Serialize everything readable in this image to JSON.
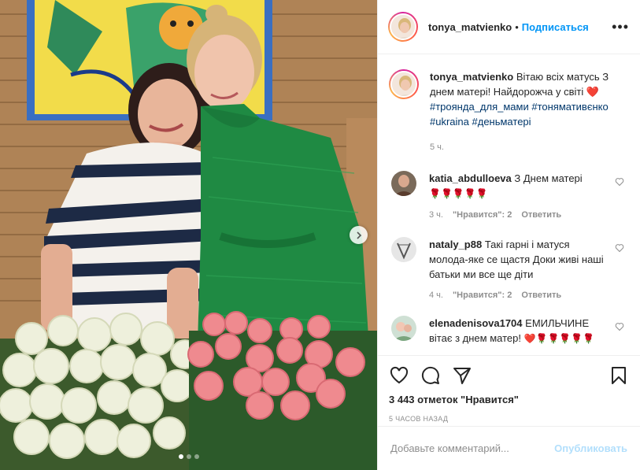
{
  "post": {
    "username": "tonya_matvienko",
    "separator": "•",
    "follow_label": "Подписаться",
    "more_label": "•••"
  },
  "caption": {
    "username": "tonya_matvienko",
    "text": "Вітаю всіх матусь З днем матері! Найдорожча у світі",
    "heart_emoji": "❤️",
    "tags": [
      "#троянда_для_мами",
      "#тонямативєнко",
      "#ukraina",
      "#деньматері"
    ],
    "time": "5 ч."
  },
  "comments": [
    {
      "username": "katia_abdulloeva",
      "text": "З Днем матері",
      "emoji": "🌹🌹🌹🌹🌹",
      "time": "3 ч.",
      "likes": "\"Нравится\": 2",
      "reply": "Ответить"
    },
    {
      "username": "nataly_p88",
      "text": "Такі гарні і матуся молода-яке се щастя Доки живі наші батьки ми все ще діти",
      "time": "4 ч.",
      "likes": "\"Нравится\": 2",
      "reply": "Ответить"
    },
    {
      "username": "elenadenisova1704",
      "text": "ЕМИЛЬЧИНЕ вітає з днем матер!",
      "emoji": "❤️🌹🌹🌹🌹🌹"
    }
  ],
  "actions": {
    "likes_count": "3 443 отметок \"Нравится\"",
    "posted_ago": "5 ЧАСОВ НАЗАД"
  },
  "add_comment": {
    "placeholder": "Добавьте комментарий...",
    "post_label": "Опубликовать"
  },
  "carousel": {
    "slides": 3,
    "active": 1
  },
  "colors": {
    "link_blue": "#0095f6",
    "tag_blue": "#00376b",
    "muted": "#8e8e8e",
    "heart_red": "#ed4956"
  }
}
